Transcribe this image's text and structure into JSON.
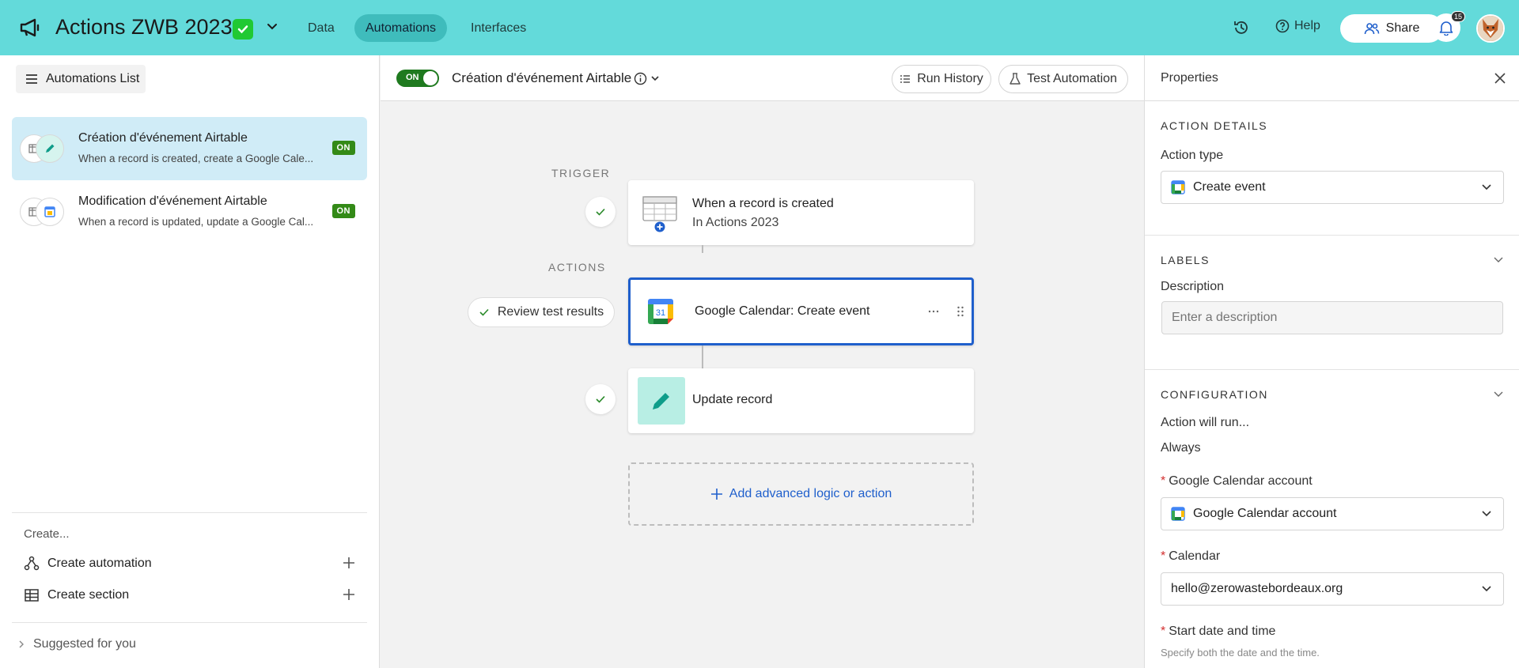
{
  "topbar": {
    "base_title": "Actions ZWB 2023",
    "nav": [
      "Data",
      "Automations",
      "Interfaces"
    ],
    "active_nav": "Automations",
    "help_label": "Help",
    "share_label": "Share",
    "notification_count": "15"
  },
  "sidebar": {
    "list_button_label": "Automations List",
    "automations": [
      {
        "name": "Création d'événement Airtable",
        "description": "When a record is created, create a Google Cale...",
        "status": "ON"
      },
      {
        "name": "Modification d'événement Airtable",
        "description": "When a record is updated, update a Google Cal...",
        "status": "ON"
      }
    ],
    "create_label": "Create...",
    "create_automation_label": "Create automation",
    "create_section_label": "Create section",
    "suggested_label": "Suggested for you"
  },
  "center": {
    "toggle_label": "ON",
    "automation_title": "Création d'événement Airtable",
    "run_history_label": "Run History",
    "test_automation_label": "Test Automation",
    "trigger_label": "TRIGGER",
    "actions_label": "ACTIONS",
    "trigger_card": {
      "title": "When a record is created",
      "subtitle": "In Actions 2023"
    },
    "action_cards": [
      {
        "title": "Google Calendar: Create event"
      },
      {
        "title": "Update record"
      }
    ],
    "review_label": "Review test results",
    "add_logic_label": "Add advanced logic or action",
    "gcal_day": "31"
  },
  "panel": {
    "title": "Properties",
    "action_details_title": "ACTION DETAILS",
    "action_type_label": "Action type",
    "action_type_value": "Create event",
    "labels_title": "LABELS",
    "description_label": "Description",
    "description_placeholder": "Enter a description",
    "configuration_title": "CONFIGURATION",
    "action_will_run_label": "Action will run...",
    "action_will_run_value": "Always",
    "required_mark": "*",
    "gcal_account_label": "Google Calendar account",
    "gcal_account_value": "Google Calendar account",
    "calendar_label": "Calendar",
    "calendar_value": "hello@zerowastebordeaux.org",
    "start_label": "Start date and time",
    "start_hint": "Specify both the date and the time."
  },
  "colors": {
    "topbar_bg": "#63dada",
    "active_nav_bg": "#3fbcbc",
    "on_badge": "#338a17",
    "selected_card_border": "#1f5fcc",
    "selected_item_bg": "#d0ecf7",
    "base_check_green": "#20c933",
    "update_record_tile": "#b8eee4"
  },
  "icons": [
    "megaphone-icon",
    "checkbox-icon",
    "chevron-down-icon",
    "history-icon",
    "help-icon",
    "share-people-icon",
    "bell-icon",
    "menu-icon",
    "table-icon",
    "pencil-icon",
    "google-calendar-icon",
    "check-icon",
    "plus-icon",
    "info-icon",
    "list-icon",
    "flask-icon",
    "close-icon",
    "automation-icon",
    "grid-icon",
    "chevron-right-icon",
    "drag-handle-icon",
    "more-icon"
  ]
}
